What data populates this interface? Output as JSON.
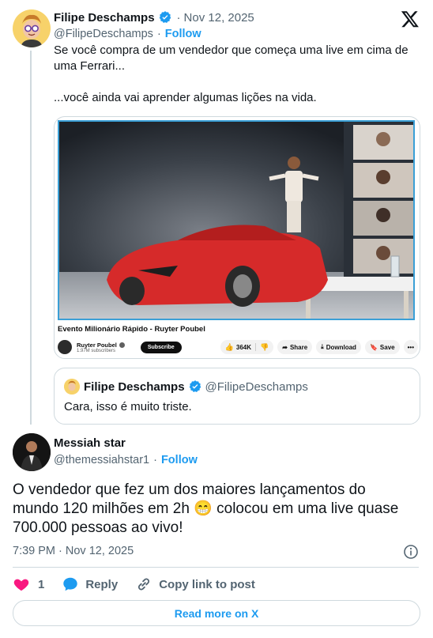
{
  "original_tweet": {
    "author_name": "Filipe Deschamps",
    "timestamp": "Nov 12, 2025",
    "handle": "@FilipeDeschamps",
    "separator": "·",
    "follow_label": "Follow",
    "text_line1": "Se você compra de um vendedor que começa uma live em cima de uma Ferrari...",
    "text_line2": "...você ainda vai aprender algumas lições na vida.",
    "media": {
      "video_title": "Evento Milionário Rápido - Ruyter Poubel",
      "channel_name": "Ruyter Poubel",
      "subscribers": "1.97M subscribers",
      "subscribe_label": "Subscribe",
      "likes": "364K",
      "share_label": "Share",
      "download_label": "Download",
      "save_label": "Save"
    },
    "quote": {
      "author_name": "Filipe Deschamps",
      "handle": "@FilipeDeschamps",
      "text": "Cara, isso é muito triste."
    }
  },
  "reply_tweet": {
    "author_name": "Messiah star",
    "handle": "@themessiahstar1",
    "separator": "·",
    "follow_label": "Follow",
    "text": "O vendedor que fez um dos maiores lançamentos do mundo 120 milhões em 2h 😁 colocou em uma live quase 700.000 pessoas ao vivo!",
    "timestamp": "7:39 PM · Nov 12, 2025",
    "like_count": "1",
    "reply_label": "Reply",
    "copy_link_label": "Copy link to post"
  },
  "read_more_label": "Read more on X",
  "colors": {
    "accent": "#1d9bf0",
    "like": "#f91880",
    "text": "#0f1419",
    "muted": "#536471",
    "border": "#cfd9de",
    "ferrari_red": "#d62a2a"
  },
  "icons": [
    "verified-badge-icon",
    "x-logo-icon",
    "info-icon",
    "heart-icon",
    "reply-bubble-icon",
    "link-icon",
    "thumbs-up-icon",
    "thumbs-down-icon",
    "share-arrow-icon",
    "download-icon",
    "bookmark-icon",
    "more-dots-icon"
  ]
}
